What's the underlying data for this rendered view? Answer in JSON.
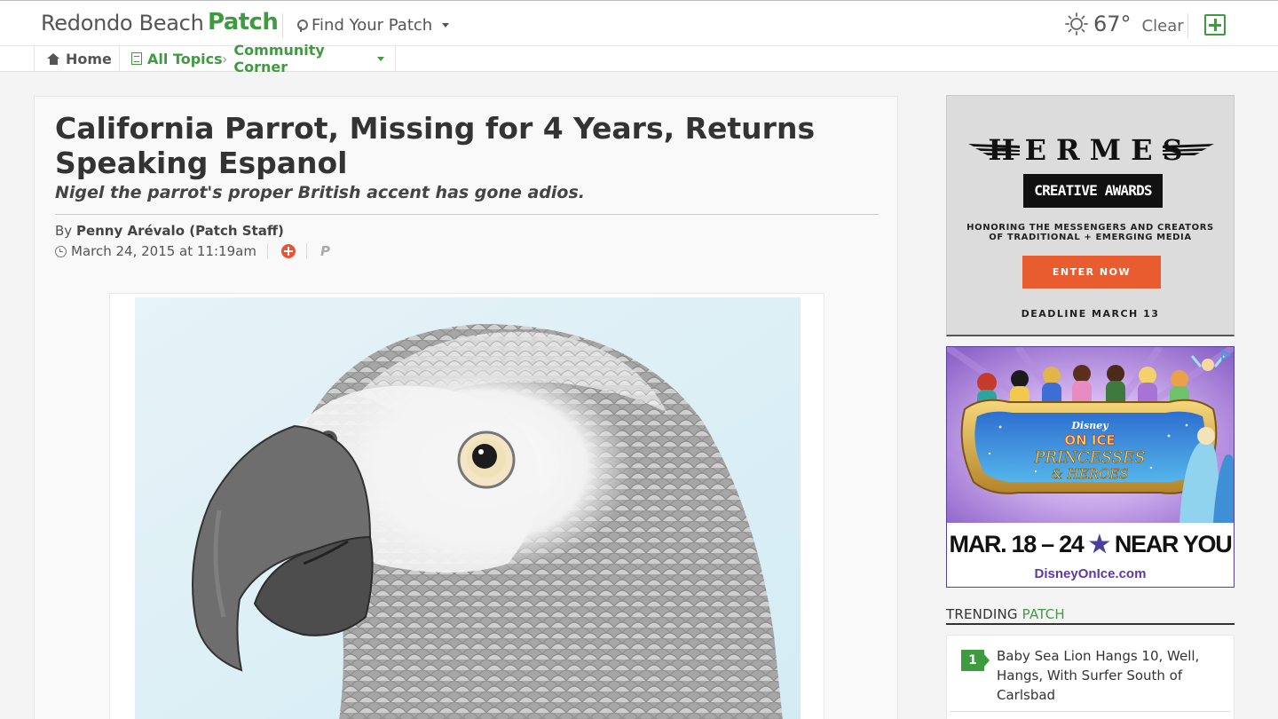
{
  "header": {
    "site_name": "Redondo Beach",
    "brand": "Patch",
    "find_patch": "Find Your Patch",
    "weather_temp": "67°",
    "weather_condition": "Clear"
  },
  "nav": {
    "home": "Home",
    "all_topics": "All Topics",
    "category": "Community Corner"
  },
  "article": {
    "title": "California Parrot, Missing for 4 Years, Returns Speaking Espanol",
    "subtitle": "Nigel the parrot's proper British accent has gone adios.",
    "byline_prefix": "By",
    "author": "Penny Arévalo (Patch Staff)",
    "date": "March 24, 2015 at 11:19am"
  },
  "ads": {
    "hermes": {
      "brand": "HERMES",
      "awards": "CREATIVE AWARDS",
      "tagline_1": "HONORING THE MESSENGERS AND CREATORS",
      "tagline_2": "OF TRADITIONAL + EMERGING MEDIA",
      "cta": "ENTER NOW",
      "deadline": "DEADLINE MARCH 13"
    },
    "disney": {
      "logo_top": "Disney",
      "logo_mid": "ON ICE",
      "logo_title_1": "PRINCESSES",
      "logo_title_2": "& HEROES",
      "dates_a": "MAR. 18 – 24",
      "star": "★",
      "dates_b": "NEAR YOU",
      "url": "DisneyOnIce.com"
    }
  },
  "trending": {
    "label_a": "TRENDING",
    "label_b": "PATCH",
    "items": [
      {
        "rank": "1",
        "title": "Baby Sea Lion Hangs 10, Well, Hangs, With Surfer South of Carlsbad"
      }
    ]
  },
  "colors": {
    "brand_green": "#3f9b3f",
    "accent_orange": "#e8543a",
    "ad_purple": "#5a3aa8"
  }
}
